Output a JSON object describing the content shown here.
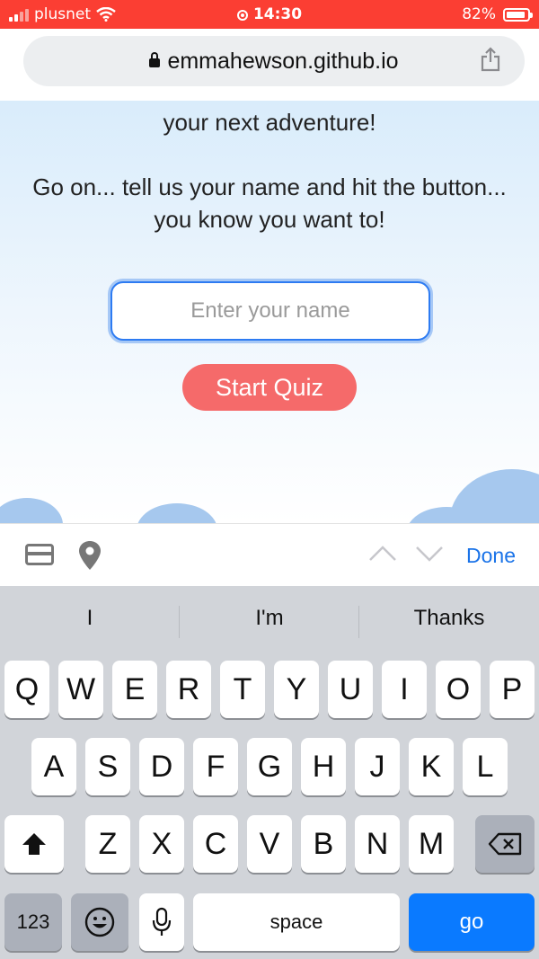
{
  "status_bar": {
    "carrier": "plusnet",
    "time": "14:30",
    "battery": "82%"
  },
  "browser": {
    "url": "emmahewson.github.io"
  },
  "page": {
    "text_line1": "your next adventure!",
    "text_line2": "Go on... tell us your name and hit the button...",
    "text_line3": "you know you want to!",
    "name_placeholder": "Enter your name",
    "start_button": "Start Quiz"
  },
  "accessory": {
    "done": "Done"
  },
  "keyboard": {
    "suggestions": [
      "I",
      "I'm",
      "Thanks"
    ],
    "row1": [
      "Q",
      "W",
      "E",
      "R",
      "T",
      "Y",
      "U",
      "I",
      "O",
      "P"
    ],
    "row2": [
      "A",
      "S",
      "D",
      "F",
      "G",
      "H",
      "J",
      "K",
      "L"
    ],
    "row3": [
      "Z",
      "X",
      "C",
      "V",
      "B",
      "N",
      "M"
    ],
    "numbers_key": "123",
    "space_key": "space",
    "go_key": "go"
  },
  "colors": {
    "status_bar": "#fb3e33",
    "start_button": "#f56a6a",
    "accent": "#1a73e8",
    "go_key": "#0a7aff"
  }
}
